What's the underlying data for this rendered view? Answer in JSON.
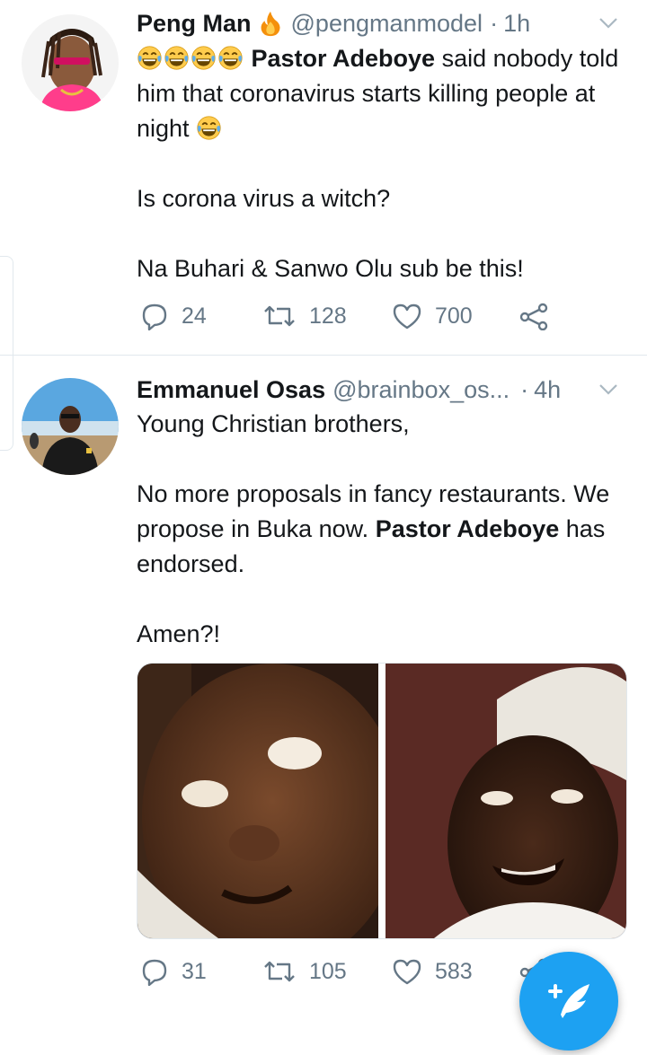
{
  "tweets": [
    {
      "name": "Peng Man",
      "handle": "@pengmanmodel",
      "separator": "·",
      "time": "1h",
      "text_bold": "Pastor Adeboye",
      "text_after_bold": " said nobody told him that coronavirus starts killing people at night",
      "line2": "Is corona virus a witch?",
      "line3": "Na Buhari & Sanwo Olu sub be this!",
      "replies": "24",
      "retweets": "128",
      "likes": "700"
    },
    {
      "name": "Emmanuel Osas",
      "handle": "@brainbox_os...",
      "separator": "·",
      "time": "4h",
      "line1": "Young Christian brothers,",
      "line2": "No more proposals in fancy restaurants. We propose in Buka now. ",
      "line2_bold": "Pastor Adeboye",
      "line2_end": " has endorsed.",
      "line3": "Amen?!",
      "replies": "31",
      "retweets": "105",
      "likes": "583"
    }
  ],
  "icons": {
    "name_badge": "fire-emoji",
    "laugh": "tears-of-joy-emoji",
    "compose": "compose-tweet-icon"
  },
  "colors": {
    "accent": "#1da1f2",
    "secondary_text": "#657786",
    "border": "#e1e8ed"
  }
}
